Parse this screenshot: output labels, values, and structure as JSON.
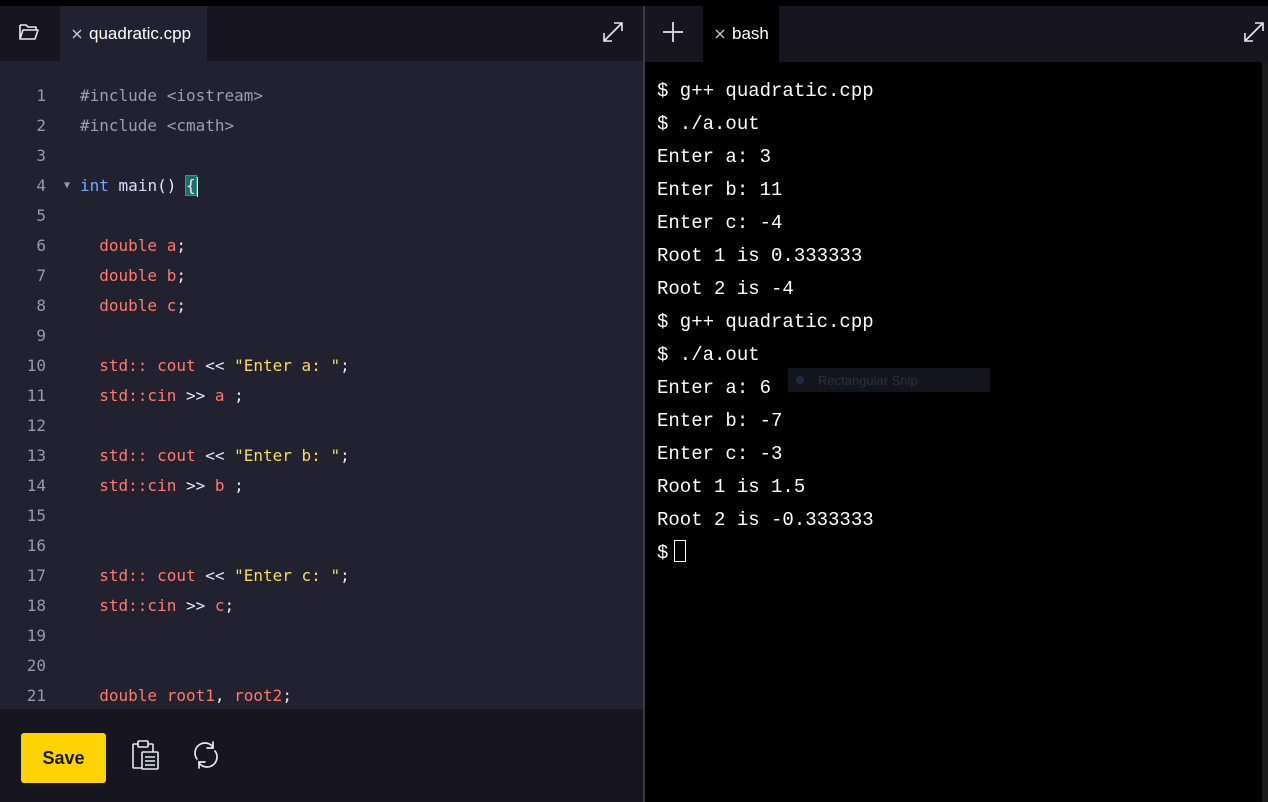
{
  "editor": {
    "tab_label": "quadratic.cpp",
    "lines": [
      {
        "n": "1",
        "html_tokens": [
          [
            "pre",
            "#include <iostream>"
          ]
        ]
      },
      {
        "n": "2",
        "html_tokens": [
          [
            "pre",
            "#include <cmath>"
          ]
        ]
      },
      {
        "n": "3",
        "html_tokens": []
      },
      {
        "n": "4",
        "html_tokens": [
          [
            "type",
            "int"
          ],
          [
            "pun",
            " "
          ],
          [
            "fn",
            "main"
          ],
          [
            "pun",
            "() "
          ],
          [
            "brace",
            "{"
          ]
        ]
      },
      {
        "n": "5",
        "html_tokens": []
      },
      {
        "n": "6",
        "html_tokens": [
          [
            "pun",
            "  "
          ],
          [
            "kw",
            "double"
          ],
          [
            "pun",
            " "
          ],
          [
            "var",
            "a"
          ],
          [
            "pun",
            ";"
          ]
        ]
      },
      {
        "n": "7",
        "html_tokens": [
          [
            "pun",
            "  "
          ],
          [
            "kw",
            "double"
          ],
          [
            "pun",
            " "
          ],
          [
            "var",
            "b"
          ],
          [
            "pun",
            ";"
          ]
        ]
      },
      {
        "n": "8",
        "html_tokens": [
          [
            "pun",
            "  "
          ],
          [
            "kw",
            "double"
          ],
          [
            "pun",
            " "
          ],
          [
            "var",
            "c"
          ],
          [
            "pun",
            ";"
          ]
        ]
      },
      {
        "n": "9",
        "html_tokens": []
      },
      {
        "n": "10",
        "html_tokens": [
          [
            "pun",
            "  "
          ],
          [
            "kw",
            "std:: cout"
          ],
          [
            "pun",
            " << "
          ],
          [
            "str",
            "\"Enter a: \""
          ],
          [
            "pun",
            ";"
          ]
        ]
      },
      {
        "n": "11",
        "html_tokens": [
          [
            "pun",
            "  "
          ],
          [
            "kw",
            "std::cin"
          ],
          [
            "pun",
            " >> "
          ],
          [
            "var",
            "a"
          ],
          [
            "pun",
            " ;"
          ]
        ]
      },
      {
        "n": "12",
        "html_tokens": []
      },
      {
        "n": "13",
        "html_tokens": [
          [
            "pun",
            "  "
          ],
          [
            "kw",
            "std:: cout"
          ],
          [
            "pun",
            " << "
          ],
          [
            "str",
            "\"Enter b: \""
          ],
          [
            "pun",
            ";"
          ]
        ]
      },
      {
        "n": "14",
        "html_tokens": [
          [
            "pun",
            "  "
          ],
          [
            "kw",
            "std::cin"
          ],
          [
            "pun",
            " >> "
          ],
          [
            "var",
            "b"
          ],
          [
            "pun",
            " ;"
          ]
        ]
      },
      {
        "n": "15",
        "html_tokens": []
      },
      {
        "n": "16",
        "html_tokens": []
      },
      {
        "n": "17",
        "html_tokens": [
          [
            "pun",
            "  "
          ],
          [
            "kw",
            "std:: cout"
          ],
          [
            "pun",
            " << "
          ],
          [
            "str",
            "\"Enter c: \""
          ],
          [
            "pun",
            ";"
          ]
        ]
      },
      {
        "n": "18",
        "html_tokens": [
          [
            "pun",
            "  "
          ],
          [
            "kw",
            "std::cin"
          ],
          [
            "pun",
            " >> "
          ],
          [
            "var",
            "c"
          ],
          [
            "pun",
            ";"
          ]
        ]
      },
      {
        "n": "19",
        "html_tokens": []
      },
      {
        "n": "20",
        "html_tokens": []
      },
      {
        "n": "21",
        "html_tokens": [
          [
            "pun",
            "  "
          ],
          [
            "kw",
            "double"
          ],
          [
            "pun",
            " "
          ],
          [
            "var",
            "root1"
          ],
          [
            "pun",
            ", "
          ],
          [
            "var",
            "root2"
          ],
          [
            "pun",
            ";"
          ]
        ]
      }
    ],
    "fold_marker": "▼",
    "fold_line": "4",
    "save_label": "Save"
  },
  "terminal": {
    "tab_label": "bash",
    "lines": [
      "$ g++ quadratic.cpp",
      "$ ./a.out",
      "Enter a: 3",
      "Enter b: 11",
      "Enter c: -4",
      "Root 1 is 0.333333",
      "Root 2 is -4",
      "$ g++ quadratic.cpp",
      "$ ./a.out",
      "Enter a: 6",
      "Enter b: -7",
      "Enter c: -3",
      "Root 1 is 1.5",
      "Root 2 is -0.333333"
    ],
    "prompt": "$",
    "overlay_text": "Rectangular Snip"
  },
  "colors": {
    "accent": "#fed305",
    "editor_bg": "#22212f",
    "tabbar_bg": "#171620",
    "terminal_bg": "#000000"
  },
  "icons": {
    "folder": "folder-open-icon",
    "close": "close-icon",
    "expand": "expand-icon",
    "add": "plus-icon",
    "clipboard": "clipboard-icon",
    "refresh": "refresh-icon"
  }
}
